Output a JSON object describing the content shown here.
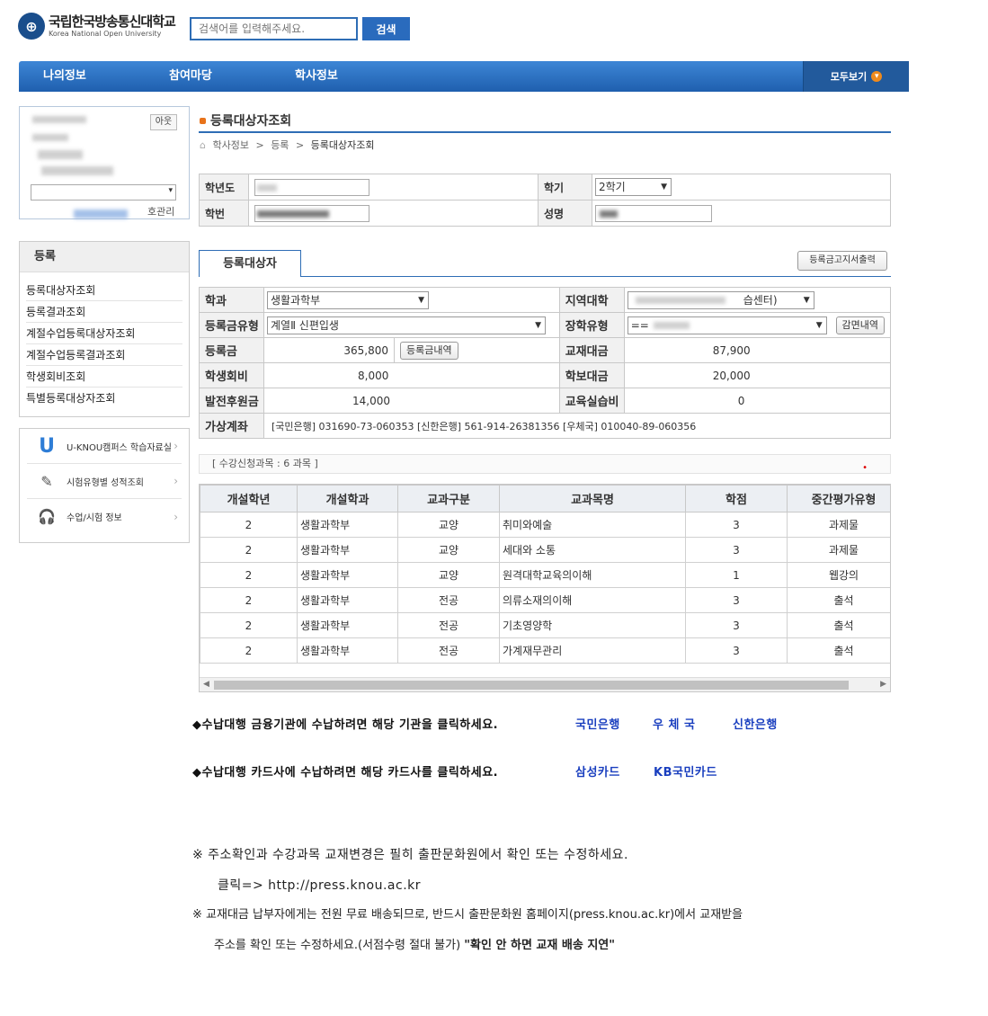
{
  "header": {
    "logo_title": "국립한국방송통신대학교",
    "logo_subtitle": "Korea National Open University",
    "search_placeholder": "검색어를 입력해주세요.",
    "search_button": "검색"
  },
  "topnav": {
    "items": [
      "나의정보",
      "참여마당",
      "학사정보"
    ],
    "all_label": "모두보기"
  },
  "profile": {
    "logout_label": "아웃",
    "pw_label": "호관리"
  },
  "leftmenu": {
    "title": "등록",
    "items": [
      "등록대상자조회",
      "등록결과조회",
      "계절수업등록대상자조회",
      "계절수업등록결과조회",
      "학생회비조회",
      "특별등록대상자조회"
    ]
  },
  "quick": {
    "items": [
      {
        "label": "U-KNOU캠퍼스 학습자료실",
        "icon": "u-knou-icon"
      },
      {
        "label": "시험유형별 성적조회",
        "icon": "exam-icon"
      },
      {
        "label": "수업/시험 정보",
        "icon": "headset-icon"
      }
    ]
  },
  "page": {
    "title": "등록대상자조회",
    "breadcrumb": [
      "학사정보",
      "등록",
      "등록대상자조회"
    ]
  },
  "info": {
    "year_label": "학년도",
    "semester_label": "학기",
    "semester_value": "2학기",
    "student_no_label": "학번",
    "name_label": "성명"
  },
  "tab": {
    "label": "등록대상자",
    "print_button": "등록금고지서출력"
  },
  "reg": {
    "dept_label": "학과",
    "dept_value": "생활과학부",
    "region_label": "지역대학",
    "region_value_suffix": "습센터)",
    "fee_type_label": "등록금유형",
    "fee_type_value": "계열Ⅱ 신편입생",
    "scholar_label": "장학유형",
    "scholar_value": "==",
    "reduction_button": "감면내역",
    "tuition_label": "등록금",
    "tuition_value": "365,800",
    "tuition_detail_button": "등록금내역",
    "textbook_label": "교재대금",
    "textbook_value": "87,900",
    "student_fee_label": "학생회비",
    "student_fee_value": "8,000",
    "newsletter_label": "학보대금",
    "newsletter_value": "20,000",
    "support_label": "발전후원금",
    "support_value": "14,000",
    "practice_label": "교육실습비",
    "practice_value": "0",
    "account_label": "가상계좌",
    "account_value": "[국민은행] 031690-73-060353 [신한은행] 561-914-26381356 [우체국] 010040-89-060356"
  },
  "courses": {
    "count_text": "[ 수강신청과목 : 6 과목 ]",
    "headers": [
      "개설학년",
      "개설학과",
      "교과구분",
      "교과목명",
      "학점",
      "중간평가유형"
    ],
    "rows": [
      [
        "2",
        "생활과학부",
        "교양",
        "취미와예술",
        "3",
        "과제물"
      ],
      [
        "2",
        "생활과학부",
        "교양",
        "세대와 소통",
        "3",
        "과제물"
      ],
      [
        "2",
        "생활과학부",
        "교양",
        "원격대학교육의이해",
        "1",
        "웹강의"
      ],
      [
        "2",
        "생활과학부",
        "전공",
        "의류소재의이해",
        "3",
        "출석"
      ],
      [
        "2",
        "생활과학부",
        "전공",
        "기초영양학",
        "3",
        "출석"
      ],
      [
        "2",
        "생활과학부",
        "전공",
        "가계재무관리",
        "3",
        "출석"
      ]
    ]
  },
  "payment": {
    "bank_text": "◆수납대행 금융기관에 수납하려면 해당 기관을 클릭하세요.",
    "banks": [
      "국민은행",
      "우 체 국",
      "신한은행"
    ],
    "card_text": "◆수납대행 카드사에 수납하려면 해당 카드사를 클릭하세요.",
    "cards": [
      "삼성카드",
      "KB국민카드"
    ]
  },
  "notices": {
    "line1": "※ 주소확인과 수강과목 교재변경은 필히 출판문화원에서 확인 또는 수정하세요.",
    "line2": "클릭=> http://press.knou.ac.kr",
    "line3": "※ 교재대금 납부자에게는 전원 무료 배송되므로, 반드시 출판문화원 홈페이지(press.knou.ac.kr)에서 교재받을",
    "line4_a": "주소를 확인 또는 수정하세요.(서점수령 절대 불가)",
    "line4_b": "\"확인 안 하면 교재 배송 지연\""
  }
}
